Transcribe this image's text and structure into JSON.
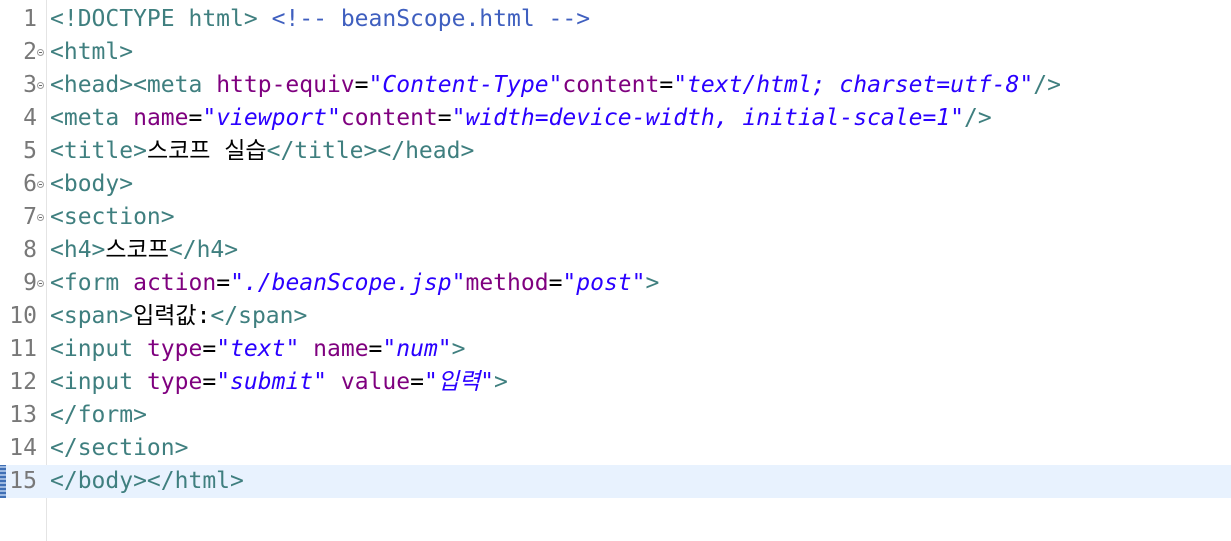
{
  "editor": {
    "current_line": 15,
    "lines": [
      {
        "n": "1",
        "fold": false,
        "tokens": [
          {
            "t": "tag",
            "v": "<!DOCTYPE html>"
          },
          {
            "t": "txt",
            "v": " "
          },
          {
            "t": "cmt",
            "v": "<!-- beanScope.html -->"
          }
        ]
      },
      {
        "n": "2",
        "fold": true,
        "tokens": [
          {
            "t": "tag",
            "v": "<html>"
          }
        ]
      },
      {
        "n": "3",
        "fold": true,
        "tokens": [
          {
            "t": "tag",
            "v": "<head><meta"
          },
          {
            "t": "txt",
            "v": " "
          },
          {
            "t": "attr",
            "v": "http-equiv"
          },
          {
            "t": "punc",
            "v": "="
          },
          {
            "t": "val",
            "v": "\"Content-Type\""
          },
          {
            "t": "attr",
            "v": "content"
          },
          {
            "t": "punc",
            "v": "="
          },
          {
            "t": "val",
            "v": "\"text/html; charset=utf-8\""
          },
          {
            "t": "tag",
            "v": "/>"
          }
        ]
      },
      {
        "n": "4",
        "fold": false,
        "tokens": [
          {
            "t": "tag",
            "v": "<meta"
          },
          {
            "t": "txt",
            "v": " "
          },
          {
            "t": "attr",
            "v": "name"
          },
          {
            "t": "punc",
            "v": "="
          },
          {
            "t": "val",
            "v": "\"viewport\""
          },
          {
            "t": "attr",
            "v": "content"
          },
          {
            "t": "punc",
            "v": "="
          },
          {
            "t": "val",
            "v": "\"width=device-width, initial-scale=1\""
          },
          {
            "t": "tag",
            "v": "/>"
          }
        ]
      },
      {
        "n": "5",
        "fold": false,
        "tokens": [
          {
            "t": "tag",
            "v": "<title>"
          },
          {
            "t": "txt",
            "v": "스코프 실습"
          },
          {
            "t": "tag",
            "v": "</title></head>"
          }
        ]
      },
      {
        "n": "6",
        "fold": true,
        "tokens": [
          {
            "t": "tag",
            "v": "<body>"
          }
        ]
      },
      {
        "n": "7",
        "fold": true,
        "tokens": [
          {
            "t": "tag",
            "v": "<section>"
          }
        ]
      },
      {
        "n": "8",
        "fold": false,
        "tokens": [
          {
            "t": "tag",
            "v": "<h4>"
          },
          {
            "t": "txt",
            "v": "스코프"
          },
          {
            "t": "tag",
            "v": "</h4>"
          }
        ]
      },
      {
        "n": "9",
        "fold": true,
        "tokens": [
          {
            "t": "tag",
            "v": "<form"
          },
          {
            "t": "txt",
            "v": " "
          },
          {
            "t": "attr",
            "v": "action"
          },
          {
            "t": "punc",
            "v": "="
          },
          {
            "t": "val",
            "v": "\"./beanScope.jsp\""
          },
          {
            "t": "attr",
            "v": "method"
          },
          {
            "t": "punc",
            "v": "="
          },
          {
            "t": "val",
            "v": "\"post\""
          },
          {
            "t": "tag",
            "v": ">"
          }
        ]
      },
      {
        "n": "10",
        "fold": false,
        "tokens": [
          {
            "t": "tag",
            "v": "<span>"
          },
          {
            "t": "txt",
            "v": "입력값:"
          },
          {
            "t": "tag",
            "v": "</span>"
          }
        ]
      },
      {
        "n": "11",
        "fold": false,
        "tokens": [
          {
            "t": "tag",
            "v": "<input"
          },
          {
            "t": "txt",
            "v": " "
          },
          {
            "t": "attr",
            "v": "type"
          },
          {
            "t": "punc",
            "v": "="
          },
          {
            "t": "val",
            "v": "\"text\""
          },
          {
            "t": "txt",
            "v": " "
          },
          {
            "t": "attr",
            "v": "name"
          },
          {
            "t": "punc",
            "v": "="
          },
          {
            "t": "val",
            "v": "\"num\""
          },
          {
            "t": "tag",
            "v": ">"
          }
        ]
      },
      {
        "n": "12",
        "fold": false,
        "tokens": [
          {
            "t": "tag",
            "v": "<input"
          },
          {
            "t": "txt",
            "v": " "
          },
          {
            "t": "attr",
            "v": "type"
          },
          {
            "t": "punc",
            "v": "="
          },
          {
            "t": "val",
            "v": "\"submit\""
          },
          {
            "t": "txt",
            "v": " "
          },
          {
            "t": "attr",
            "v": "value"
          },
          {
            "t": "punc",
            "v": "="
          },
          {
            "t": "val",
            "v": "\"입력\""
          },
          {
            "t": "tag",
            "v": ">"
          }
        ]
      },
      {
        "n": "13",
        "fold": false,
        "tokens": [
          {
            "t": "tag",
            "v": "</form>"
          }
        ]
      },
      {
        "n": "14",
        "fold": false,
        "tokens": [
          {
            "t": "tag",
            "v": "</section>"
          }
        ]
      },
      {
        "n": "15",
        "fold": false,
        "tokens": [
          {
            "t": "tag",
            "v": "</body></html>"
          }
        ]
      }
    ]
  },
  "colors": {
    "tag": "#3f7f7f",
    "attribute": "#7f007f",
    "value": "#2a00ff",
    "comment": "#3f5fbf",
    "current_line_bg": "#e8f2fe",
    "line_number": "#787878"
  }
}
